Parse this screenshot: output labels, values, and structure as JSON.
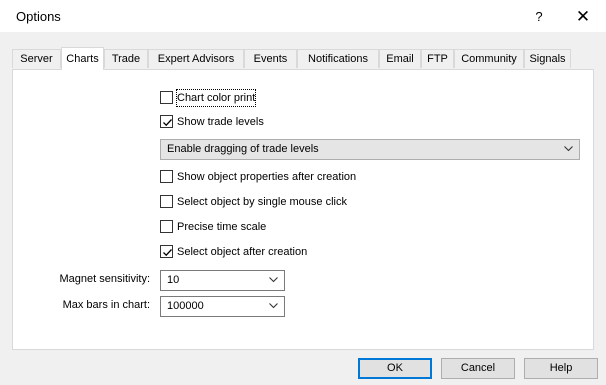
{
  "window": {
    "title": "Options",
    "help_glyph": "?",
    "close_glyph": "✕"
  },
  "tabs": [
    {
      "label": "Server"
    },
    {
      "label": "Charts",
      "active": true
    },
    {
      "label": "Trade"
    },
    {
      "label": "Expert Advisors"
    },
    {
      "label": "Events"
    },
    {
      "label": "Notifications"
    },
    {
      "label": "Email"
    },
    {
      "label": "FTP"
    },
    {
      "label": "Community"
    },
    {
      "label": "Signals"
    }
  ],
  "charts": {
    "chart_color_print": {
      "label": "Chart color print",
      "checked": false
    },
    "show_trade_levels": {
      "label": "Show trade levels",
      "checked": true
    },
    "trade_levels_dropdown": {
      "value": "Enable dragging of trade levels"
    },
    "show_object_properties": {
      "label": "Show object properties after creation",
      "checked": false
    },
    "select_single_click": {
      "label": "Select object by single mouse click",
      "checked": false
    },
    "precise_time_scale": {
      "label": "Precise time scale",
      "checked": false
    },
    "select_after_creation": {
      "label": "Select object after creation",
      "checked": true
    },
    "magnet_sensitivity": {
      "label": "Magnet sensitivity:",
      "value": "10"
    },
    "max_bars": {
      "label": "Max bars in chart:",
      "value": "100000"
    }
  },
  "buttons": {
    "ok": "OK",
    "cancel": "Cancel",
    "help": "Help"
  },
  "colors": {
    "background": "#f0f0f0",
    "panel": "#ffffff",
    "accent": "#0078d7"
  }
}
